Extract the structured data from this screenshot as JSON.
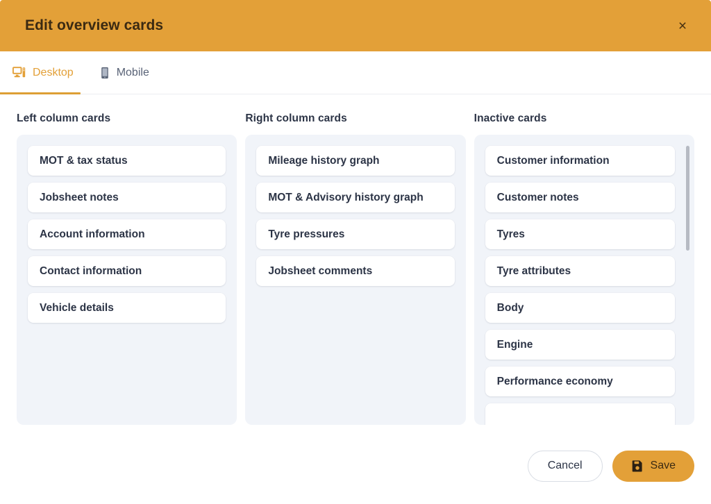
{
  "header": {
    "title": "Edit overview cards",
    "close_label": "×",
    "background_color": "#e3a038",
    "title_color": "#3b2a12"
  },
  "tabs": [
    {
      "label": "Desktop",
      "icon": "desktop-icon",
      "active": true,
      "color": "#e3a038"
    },
    {
      "label": "Mobile",
      "icon": "mobile-icon",
      "active": false,
      "color": "#586276"
    }
  ],
  "columns": [
    {
      "key": "left",
      "title": "Left column cards",
      "scrollable": false,
      "cards": [
        "MOT & tax status",
        "Jobsheet notes",
        "Account information",
        "Contact information",
        "Vehicle details"
      ]
    },
    {
      "key": "right",
      "title": "Right column cards",
      "scrollable": false,
      "cards": [
        "Mileage history graph",
        "MOT & Advisory history graph",
        "Tyre pressures",
        "Jobsheet comments"
      ]
    },
    {
      "key": "inactive",
      "title": "Inactive cards",
      "scrollable": true,
      "cards": [
        "Customer information",
        "Customer notes",
        "Tyres",
        "Tyre attributes",
        "Body",
        "Engine",
        "Performance economy",
        ""
      ]
    }
  ],
  "scrollbar": {
    "thumb_top_pct": 0,
    "thumb_height_pct": 39,
    "thumb_color": "#b6bac3"
  },
  "footer": {
    "cancel_label": "Cancel",
    "save_label": "Save",
    "save_icon": "floppy-disk-save-icon",
    "save_color": "#e3a038"
  },
  "theme": {
    "accent": "#e3a038",
    "column_bg": "#f1f4f9",
    "card_bg": "#ffffff",
    "text_dark": "#2c3446"
  }
}
